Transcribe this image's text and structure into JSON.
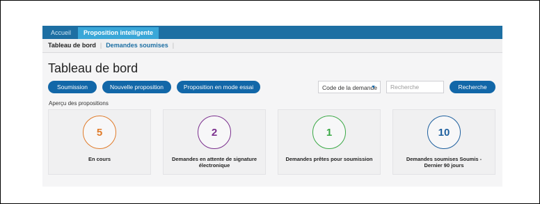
{
  "tabs": [
    {
      "label": "Accueil",
      "active": false
    },
    {
      "label": "Proposition intelligente",
      "active": true
    }
  ],
  "breadcrumb": {
    "item1": "Tableau de bord",
    "separator": "|",
    "item2": "Demandes soumises",
    "trailing_separator": "|"
  },
  "page_title": "Tableau de bord",
  "buttons": {
    "soumission": "Soumission",
    "nouvelle_proposition": "Nouvelle proposition",
    "mode_essai": "Proposition en mode essai",
    "recherche": "Recherche"
  },
  "filter": {
    "select_value": "Code de la demande",
    "search_placeholder": "Recherche"
  },
  "overview_label": "Aperçu des propositions",
  "cards": [
    {
      "count": "5",
      "label": "En cours",
      "color": "#e07b2a"
    },
    {
      "count": "2",
      "label": "Demandes en attente de signature électronique",
      "color": "#7b2f8e"
    },
    {
      "count": "1",
      "label": "Demandes prêtes pour soumission",
      "color": "#3aa845"
    },
    {
      "count": "10",
      "label": "Demandes soumises Soumis - Dernier 90 jours",
      "color": "#1d5f9e"
    }
  ],
  "colors": {
    "topbar": "#1d6fa3",
    "active_tab": "#3aa7d8",
    "button": "#1267a8",
    "link": "#1d6fa3"
  },
  "icons": {
    "select_caret": "caret-down-icon"
  }
}
